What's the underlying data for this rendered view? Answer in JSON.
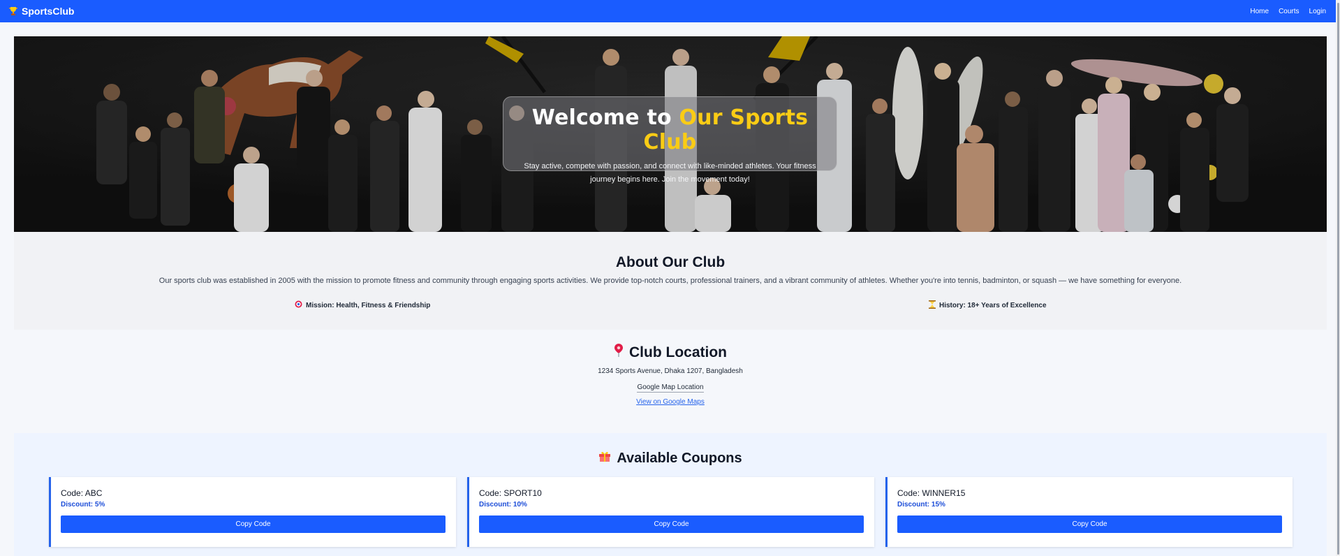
{
  "navbar": {
    "brand": "SportsClub",
    "links": [
      "Home",
      "Courts",
      "Login"
    ]
  },
  "hero": {
    "title_prefix": "Welcome to ",
    "title_highlight": "Our Sports Club",
    "subtitle": "Stay active, compete with passion, and connect with like-minded athletes. Your fitness journey begins here. Join the movement today!"
  },
  "about": {
    "title": "About Our Club",
    "text": "Our sports club was established in 2005 with the mission to promote fitness and community through engaging sports activities. We provide top-notch courts, professional trainers, and a vibrant community of athletes. Whether you're into tennis, badminton, or squash — we have something for everyone.",
    "mission": "Mission: Health, Fitness & Friendship",
    "history": "History: 18+ Years of Excellence"
  },
  "location": {
    "title": "Club Location",
    "address": "1234 Sports Avenue, Dhaka 1207, Bangladesh",
    "map_label": "Google Map Location",
    "map_link": "View on Google Maps"
  },
  "coupons": {
    "title": "Available Coupons",
    "items": [
      {
        "code": "Code: ABC",
        "discount": "Discount: 5%",
        "button": "Copy Code"
      },
      {
        "code": "Code: SPORT10",
        "discount": "Discount: 10%",
        "button": "Copy Code"
      },
      {
        "code": "Code: WINNER15",
        "discount": "Discount: 15%",
        "button": "Copy Code"
      }
    ]
  },
  "colors": {
    "primary": "#1a5cff",
    "highlight": "#facc15",
    "link": "#2563eb"
  },
  "icons": {
    "brand": "trophy-icon",
    "mission": "target-icon",
    "history": "hourglass-icon",
    "location": "pin-icon",
    "coupons": "gift-icon"
  }
}
